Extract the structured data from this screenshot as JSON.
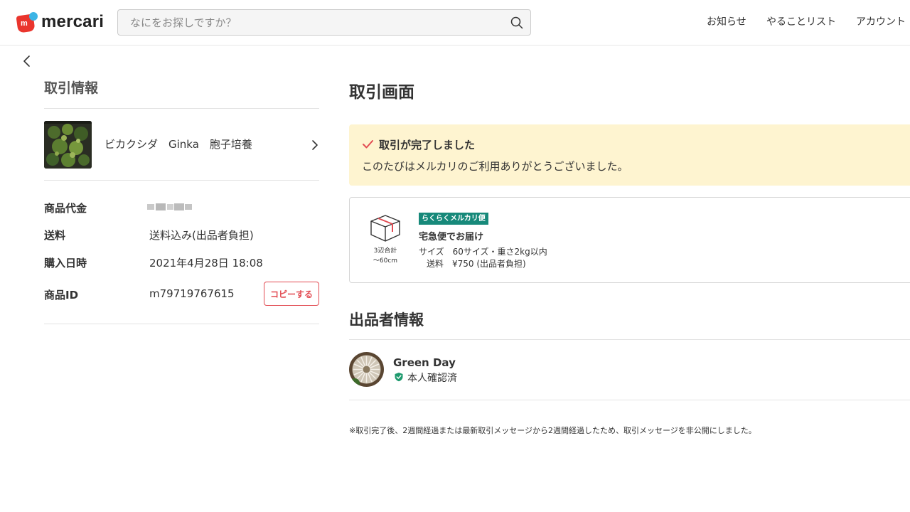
{
  "header": {
    "logo_text": "mercari",
    "logo_mark": "m",
    "search_placeholder": "なにをお探しですか？",
    "nav": [
      "お知らせ",
      "やることリスト",
      "アカウント"
    ],
    "brand_red": "#ea352d",
    "brand_blue": "#3cb4e5"
  },
  "left": {
    "section_title": "取引情報",
    "item_name": "ビカクシダ　Ginka　胞子培養",
    "info": {
      "price_label": "商品代金",
      "shipping_label": "送料",
      "shipping_value": "送料込み(出品者負担)",
      "purchase_label": "購入日時",
      "purchase_value": "2021年4月28日 18:08",
      "id_label": "商品ID",
      "id_value": "m79719767615"
    },
    "copy_button": "コピーする",
    "accent": "#e24b52"
  },
  "right": {
    "title": "取引画面",
    "complete_title": "取引が完了しました",
    "complete_message": "このたびはメルカリのご利用ありがとうございました。",
    "shipping": {
      "box_caption_1": "3辺合計",
      "box_caption_2": "〜60cm",
      "badge": "らくらくメルカリ便",
      "method": "宅急便でお届け",
      "size": "サイズ　60サイズ・重さ2kg以内",
      "fee": "送料　¥750 (出品者負担)",
      "badge_color": "#17897a"
    },
    "seller_section_title": "出品者情報",
    "seller_name": "Green Day",
    "verified": "本人確認済",
    "footnote": "※取引完了後、2週間経過または最新取引メッセージから2週間経過したため、取引メッセージを非公開にしました。"
  }
}
